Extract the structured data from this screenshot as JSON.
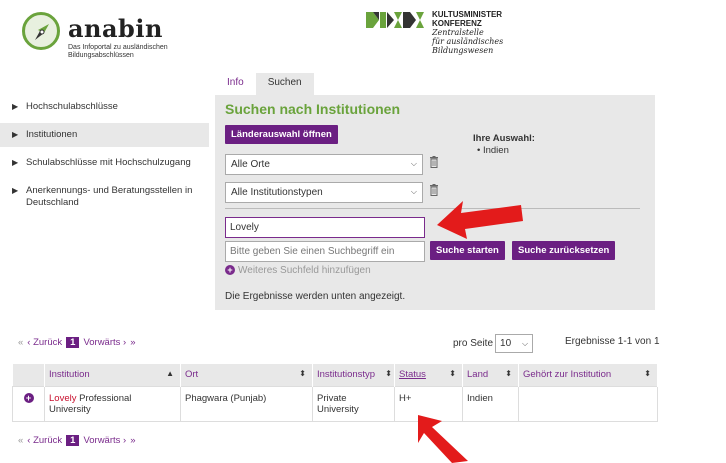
{
  "header": {
    "logo_name": "anabin",
    "logo_sub_1": "Das Infoportal zu ausländischen",
    "logo_sub_2": "Bildungsabschlüssen",
    "kmk_line1": "KULTUSMINISTER",
    "kmk_line2": "KONFERENZ",
    "kmk_line3": "Zentralstelle",
    "kmk_line4": "für ausländisches",
    "kmk_line5": "Bildungswesen"
  },
  "tabs": [
    {
      "label": "Info"
    },
    {
      "label": "Suchen"
    }
  ],
  "sidebar": {
    "items": [
      {
        "label": "Hochschulabschlüsse"
      },
      {
        "label": "Institutionen"
      },
      {
        "label": "Schulabschlüsse mit Hochschulzugang"
      },
      {
        "label": "Anerkennungs- und Beratungsstellen in Deutschland"
      }
    ]
  },
  "search": {
    "title": "Suchen nach Institutionen",
    "country_button": "Länderauswahl öffnen",
    "selection_heading": "Ihre Auswahl:",
    "selection_item": "Indien",
    "place_select": "Alle Orte",
    "type_select": "Alle Institutionstypen",
    "query_value": "Lovely",
    "query_placeholder": "Bitte geben Sie einen Suchbegriff ein",
    "start_button": "Suche starten",
    "reset_button": "Suche zurücksetzen",
    "add_field": "Weiteres Suchfeld hinzufügen",
    "results_note": "Die Ergebnisse werden unten angezeigt."
  },
  "pager": {
    "first": "«",
    "prev": "‹ Zurück",
    "current": "1",
    "next": "Vorwärts ›",
    "last": "»",
    "per_page_label": "pro Seite",
    "per_page_value": "10",
    "results_count": "Ergebnisse 1-1 von 1"
  },
  "table": {
    "headers": [
      "Institution",
      "Ort",
      "Institutionstyp",
      "Status",
      "Land",
      "Gehört zur Institution"
    ],
    "rows": [
      {
        "institution_hl": "Lovely",
        "institution_rest": " Professional",
        "institution_line2": "University",
        "ort": "Phagwara (Punjab)",
        "typ_line1": "Private",
        "typ_line2": "University",
        "status": "H+",
        "land": "Indien",
        "gehoert": ""
      }
    ]
  },
  "colors": {
    "accent_purple": "#6b1f82",
    "title_green": "#6aa33c",
    "highlight_red": "#c8102e",
    "annotation_arrow": "#e31b1b"
  }
}
